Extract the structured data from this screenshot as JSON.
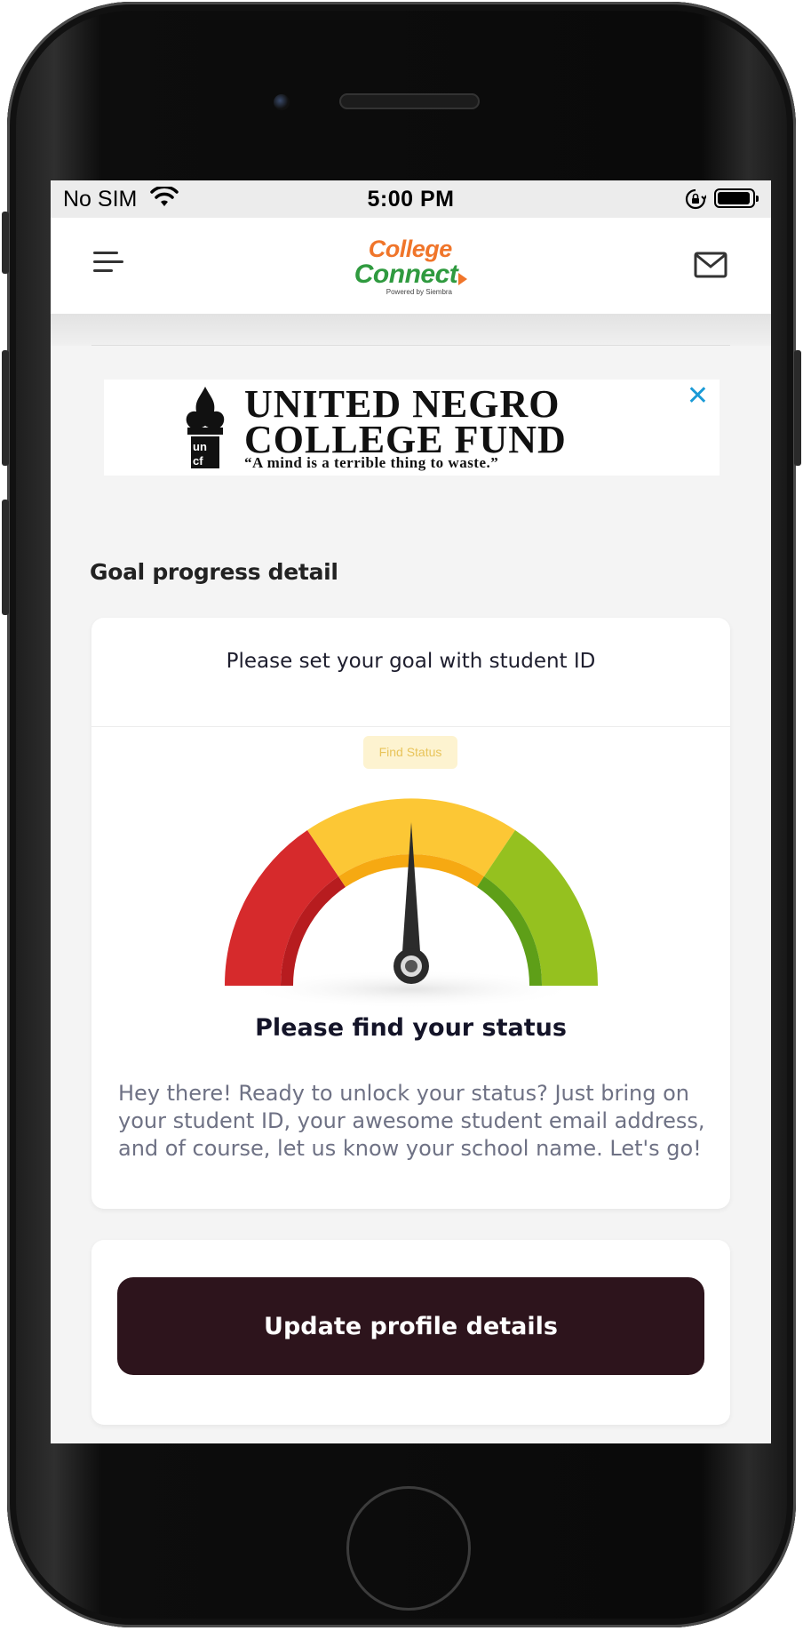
{
  "status_bar": {
    "carrier": "No SIM",
    "time": "5:00 PM"
  },
  "header": {
    "logo_line1": "College",
    "logo_line2": "Connect",
    "logo_powered": "Powered by Siembra",
    "menu_icon": "hamburger-menu-icon",
    "mail_icon": "mail-icon"
  },
  "ad": {
    "line1": "UNITED NEGRO",
    "line2": "COLLEGE FUND",
    "tagline": "“A mind is a terrible thing to waste.”",
    "close_label": "✕"
  },
  "section_title": "Goal progress detail",
  "goal_card": {
    "title": "Please set your goal with student ID",
    "chip_label": "Find Status",
    "status_heading": "Please find your status",
    "description": "Hey there! Ready to unlock your status? Just bring on your student ID, your awesome student email address, and of course, let us know your school name. Let's go!",
    "gauge_colors": [
      "#d9272b",
      "#fbc531",
      "#8cc31e"
    ],
    "needle_value": 0.5
  },
  "actions": {
    "update_label": "Update profile details"
  }
}
